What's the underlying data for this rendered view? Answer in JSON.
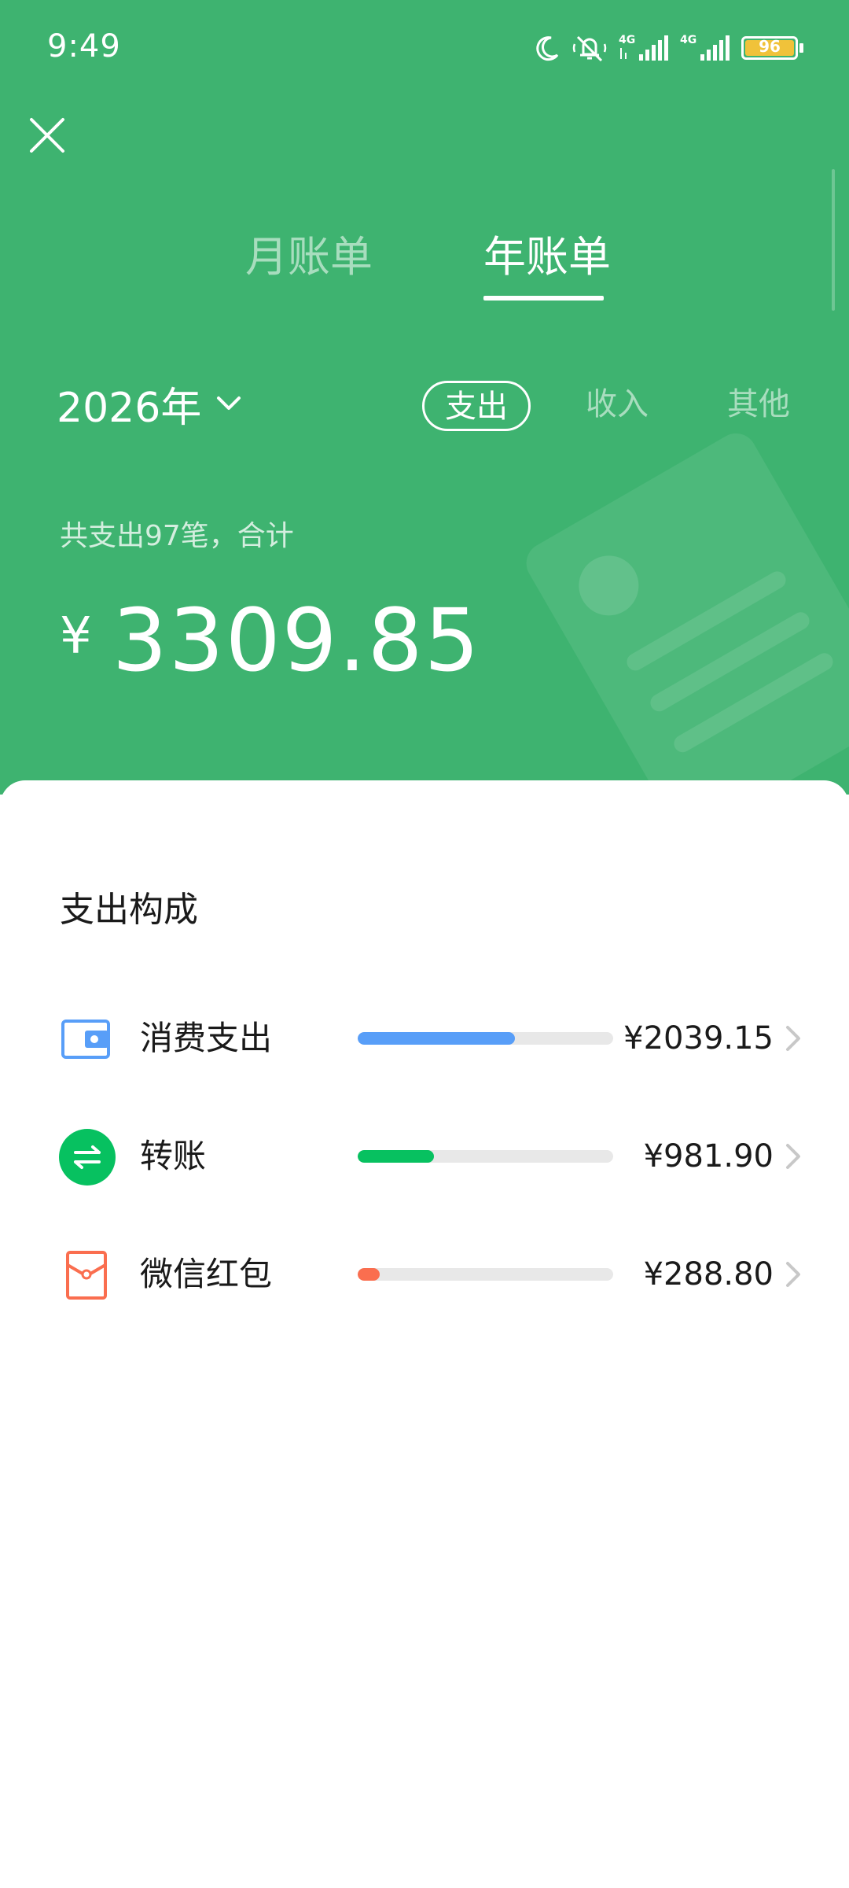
{
  "status_bar": {
    "time": "9:49",
    "network_label_1": "4G",
    "network_label_2": "4G",
    "battery": "96",
    "icons": [
      "moon-icon",
      "muted-bell-icon",
      "signal-icon",
      "signal-icon",
      "battery-icon"
    ]
  },
  "tabs": {
    "month": "月账单",
    "year": "年账单",
    "active": "year"
  },
  "year_selector": {
    "label": "2026年"
  },
  "filters": {
    "expense": "支出",
    "income": "收入",
    "other": "其他",
    "active": "expense"
  },
  "summary": {
    "text": "共支出97笔，合计",
    "currency": "¥",
    "amount": "3309.85"
  },
  "breakdown": {
    "title": "支出构成",
    "items": [
      {
        "label": "消费支出",
        "amount": "¥2039.15",
        "fraction": 0.616,
        "color": "#589ef8",
        "icon": "wallet-icon"
      },
      {
        "label": "转账",
        "amount": "¥981.90",
        "fraction": 0.297,
        "color": "#07c160",
        "icon": "transfer-icon"
      },
      {
        "label": "微信红包",
        "amount": "¥288.80",
        "fraction": 0.087,
        "color": "#fa6e4f",
        "icon": "red-packet-icon"
      }
    ]
  },
  "colors": {
    "header_bg": "#3eb370",
    "track": "#e8e8e8"
  }
}
